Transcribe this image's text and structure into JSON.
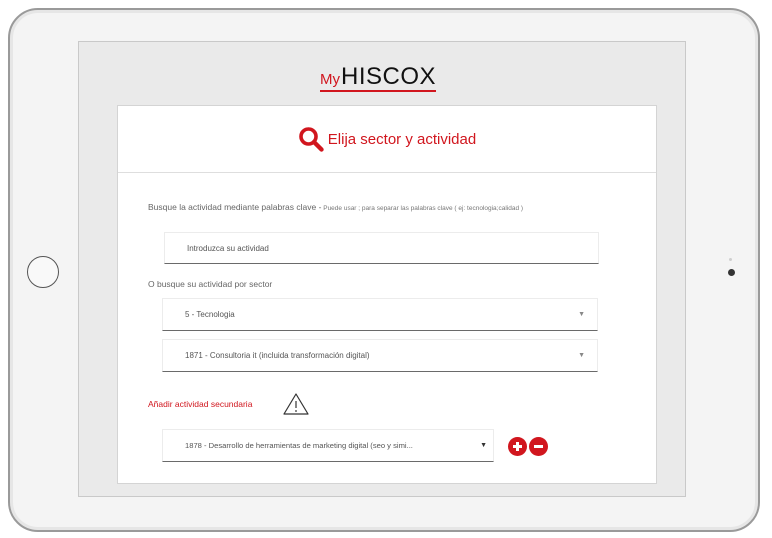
{
  "logo": {
    "prefix": "My",
    "brand": "HISCOX"
  },
  "card": {
    "title": "Elija sector y actividad"
  },
  "keyword_search": {
    "label": "Busque la actividad mediante palabras clave -",
    "hint": " Puede usar ; para separar las palabras clave ( ej: tecnologia;calidad )",
    "placeholder": "Introduzca su actividad"
  },
  "sector_search": {
    "label": "O busque su actividad por sector",
    "sector_value": "5 - Tecnologia",
    "activity_value": "1871 - Consultoria it (incluida transformación digital)"
  },
  "secondary": {
    "label": "Añadir actividad secundaria",
    "value": "1878 - Desarrollo de herramientas de marketing digital (seo y simi...",
    "caret": "▼"
  },
  "carets": {
    "select": "▼"
  },
  "colors": {
    "accent": "#d1161e"
  },
  "icons": [
    "search-icon",
    "warning-icon",
    "plus-icon",
    "minus-icon",
    "chevron-down-icon"
  ]
}
